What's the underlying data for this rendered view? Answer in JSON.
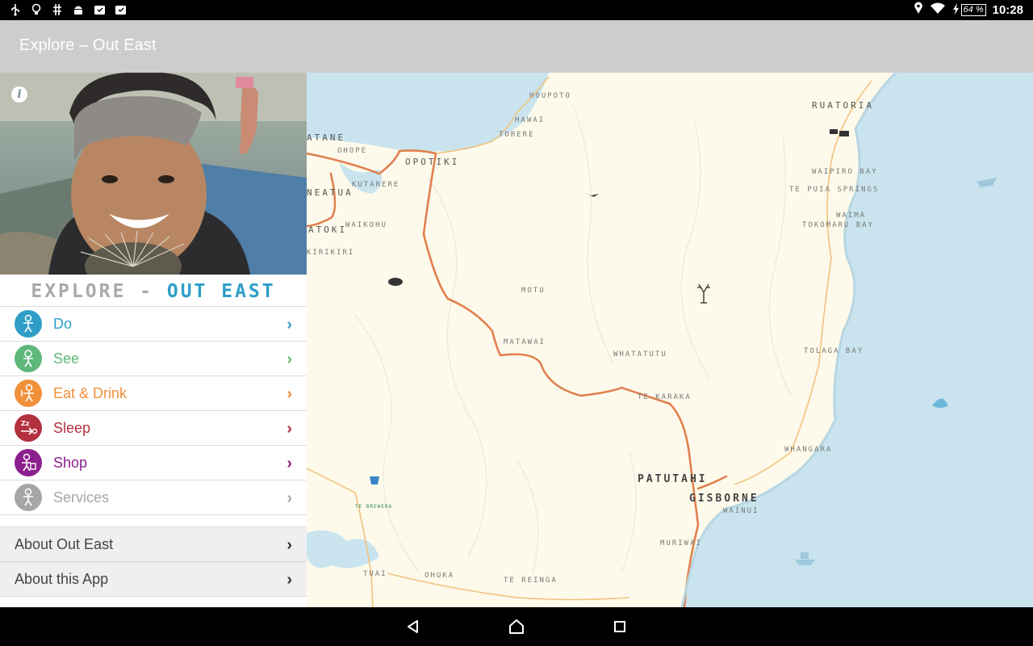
{
  "status_bar": {
    "time": "10:28",
    "battery": "64 %",
    "left_icons": [
      "usb-icon",
      "lightbulb-icon",
      "debug-icon",
      "android-icon",
      "notification-icon",
      "notification-icon"
    ],
    "right_icons": [
      "location-icon",
      "wifi-icon",
      "charging-icon",
      "battery-icon"
    ]
  },
  "app_bar": {
    "title": "Explore – Out East"
  },
  "panel": {
    "brand_part1": "EXPLORE - ",
    "brand_part2": "OUT EAST",
    "menu": [
      {
        "label": "Do",
        "color": "#2e9ec7"
      },
      {
        "label": "See",
        "color": "#5db87a"
      },
      {
        "label": "Eat & Drink",
        "color": "#f0903a"
      },
      {
        "label": "Sleep",
        "color": "#b3303e"
      },
      {
        "label": "Shop",
        "color": "#8c1f8e"
      },
      {
        "label": "Services",
        "color": "#a6a6a6"
      }
    ],
    "about": [
      {
        "label": "About Out East"
      },
      {
        "label": "About this App"
      }
    ]
  },
  "map": {
    "places": [
      "HOUPOTO",
      "HAWAI",
      "TORERE",
      "RUATORIA",
      "ATANE",
      "OHOPE",
      "OPOTIKI",
      "KUTARERE",
      "NEATUA",
      "WAIPIRO BAY",
      "TE PUIA SPRINGS",
      "WAIMA",
      "TOKOMARU BAY",
      "ATOKI",
      "WAIKOHU",
      "KIRIKIRI",
      "MOTU",
      "MATAWAI",
      "WHATATUTU",
      "TOLAGA BAY",
      "TE KARAKA",
      "WHANGARA",
      "PATUTAHI",
      "GISBORNE",
      "WAINUI",
      "TE BREWERA",
      "MURIWAI",
      "TUAI",
      "OHUKA",
      "TE REINGA"
    ]
  },
  "colors": {
    "app_bar": "#cdcdcd",
    "sea": "#c9e4ee",
    "land": "#fdfaeb",
    "road": "#e0814f"
  }
}
